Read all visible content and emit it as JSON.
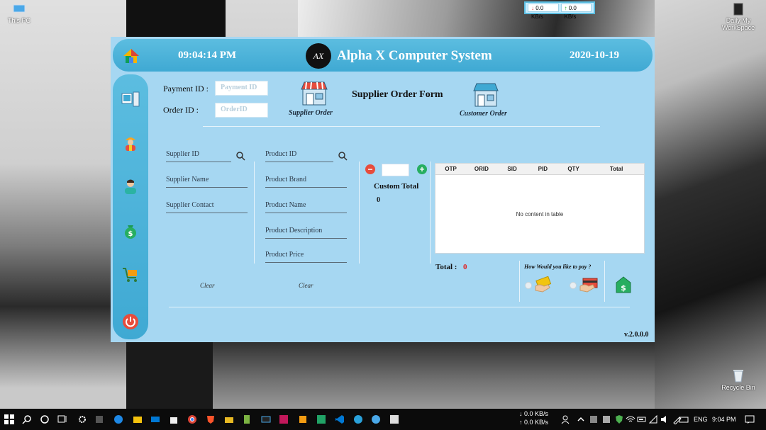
{
  "desktop": {
    "this_pc_label": "This PC",
    "workspace_label": "Daily My WorkSpace",
    "recycle_label": "Recycle Bin",
    "net_down": "0.0 KB/s",
    "net_up": "0.0 KB/s"
  },
  "app": {
    "time": "09:04:14 PM",
    "title": "Alpha X Computer System",
    "date": "2020-10-19",
    "logo_text": "AX",
    "payment_id_label": "Payment ID :",
    "payment_id_placeholder": "Payment ID",
    "order_id_label": "Order ID :",
    "order_id_placeholder": "OrderID",
    "supplier_order_label": "Supplier Order",
    "form_title": "Supplier Order Form",
    "customer_order_label": "Customer Order",
    "supplier_fields": [
      "Supplier ID",
      "Supplier Name",
      "Supplier Contact"
    ],
    "product_fields": [
      "Product ID",
      "Product Brand",
      "Product Name",
      "Product Description",
      "Product Price"
    ],
    "clear_label": "Clear",
    "custom_total_label": "Custom Total",
    "custom_total_value": "0",
    "table": {
      "columns": [
        "OTP",
        "ORID",
        "SID",
        "PID",
        "QTY",
        "Total"
      ],
      "empty_text": "No content in table"
    },
    "total_label": "Total :",
    "total_value": "0",
    "pay_question": "How Would you like to pay ?",
    "version": "v.2.0.0.0"
  },
  "taskbar": {
    "net_down": "0.0 KB/s",
    "net_up": "0.0 KB/s",
    "language": "ENG",
    "time": "9:04 PM"
  }
}
